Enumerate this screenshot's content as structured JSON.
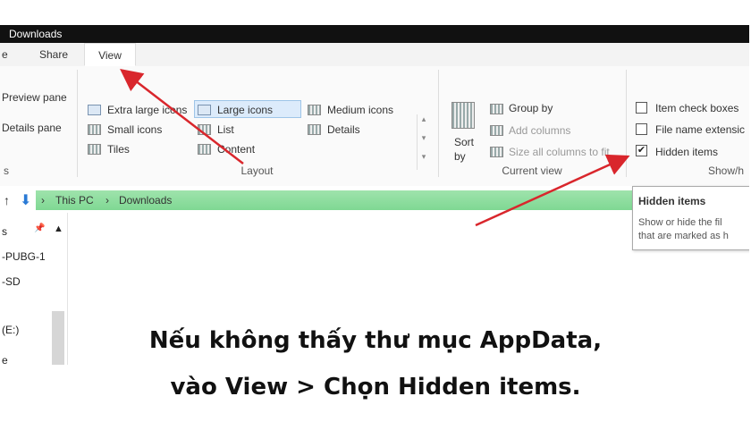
{
  "window": {
    "title": "Downloads"
  },
  "tabs": [
    {
      "label": "e"
    },
    {
      "label": "Share"
    },
    {
      "label": "View"
    }
  ],
  "ribbon": {
    "panes": {
      "preview": "Preview pane",
      "details": "Details pane",
      "group_label": "s"
    },
    "layout": {
      "items": [
        "Extra large icons",
        "Large icons",
        "Medium icons",
        "Small icons",
        "List",
        "Details",
        "Tiles",
        "Content"
      ],
      "selected": "Large icons",
      "group_label": "Layout"
    },
    "current_view": {
      "sort_by": [
        "Sort",
        "by"
      ],
      "group_by": "Group by",
      "add_columns": "Add columns",
      "size_all": "Size all columns to fit",
      "group_label": "Current view"
    },
    "show_hide": {
      "item_check_boxes": "Item check boxes",
      "file_name_extensions": "File name extensic",
      "hidden_items": "Hidden items",
      "hidden_items_checked": true,
      "group_label": "Show/h"
    }
  },
  "address": {
    "segments": [
      "This PC",
      "Downloads"
    ],
    "separator": "›"
  },
  "nav": {
    "items": [
      "s",
      "-PUBG-1",
      "-SD",
      "(E:)",
      "e"
    ]
  },
  "tooltip": {
    "title": "Hidden items",
    "line1": "Show or hide the fil",
    "line2": "that are marked as h"
  },
  "caption": {
    "line1": "Nếu không thấy thư mục AppData,",
    "line2": "vào View > Chọn Hidden items."
  },
  "colors": {
    "arrow": "#d9262c",
    "address_bar": "#8fdc9f",
    "selected_layout": "#dcebfb"
  }
}
